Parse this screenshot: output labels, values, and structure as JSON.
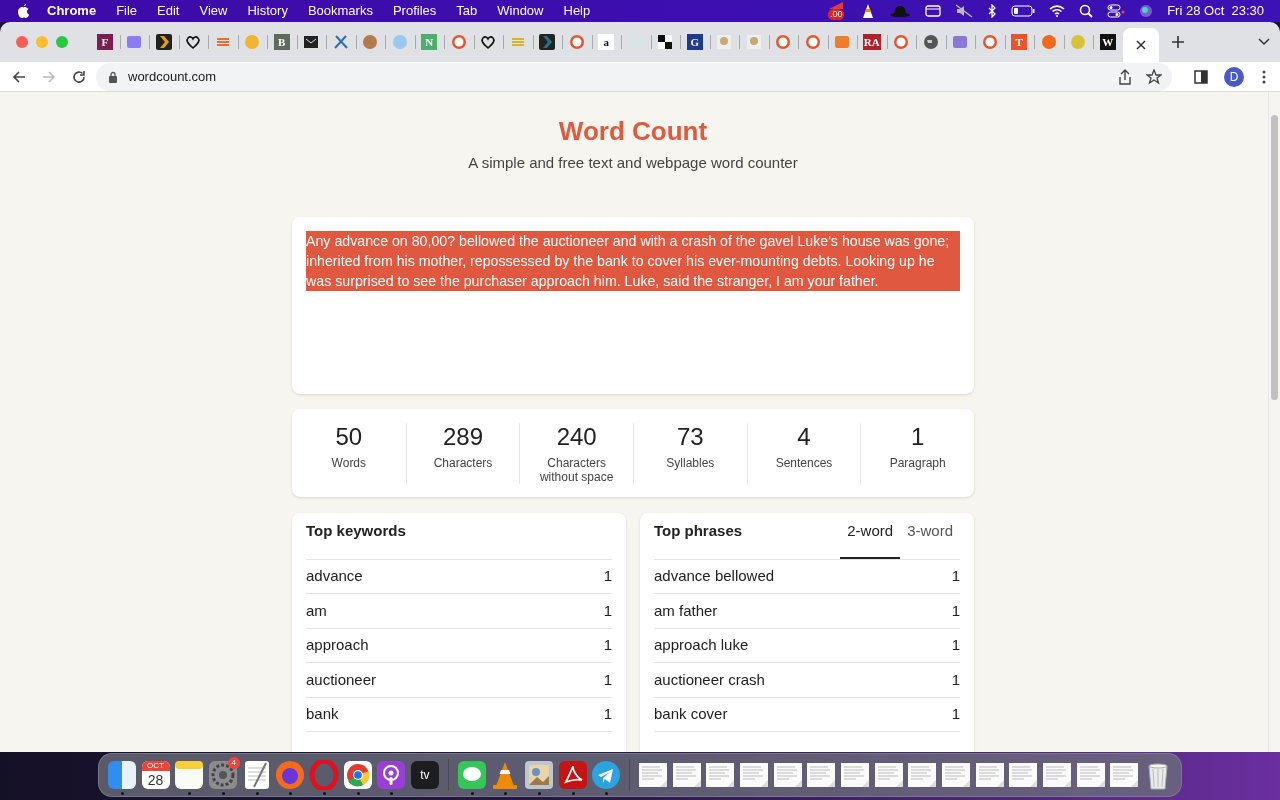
{
  "menu_bar": {
    "app": "Chrome",
    "items": [
      "File",
      "Edit",
      "View",
      "History",
      "Bookmarks",
      "Profiles",
      "Tab",
      "Window",
      "Help"
    ],
    "status_badge": ".00",
    "clock": "Fri 28 Oct  23:30"
  },
  "tabs": [
    {
      "kind": "letter",
      "letter": "F",
      "color": "#7a1f4f",
      "selected": false
    },
    {
      "kind": "square",
      "color": "#8b7cf6",
      "selected": false
    },
    {
      "kind": "chevron",
      "color": "#e5a00d",
      "selected": false
    },
    {
      "kind": "heart",
      "color": "#111111",
      "selected": false
    },
    {
      "kind": "stripes",
      "color": "#e0703a",
      "selected": false
    },
    {
      "kind": "circle",
      "color": "#f2b533",
      "selected": false
    },
    {
      "kind": "letter",
      "letter": "B",
      "color": "#5d6b5e",
      "selected": false
    },
    {
      "kind": "envelope",
      "color": "#222222",
      "selected": false
    },
    {
      "kind": "cross",
      "color": "#2f6fb0",
      "selected": false
    },
    {
      "kind": "circle",
      "color": "#b27b4e",
      "selected": false
    },
    {
      "kind": "circle",
      "color": "#9cc8ef",
      "selected": false
    },
    {
      "kind": "letter",
      "letter": "N",
      "color": "#4caf6e",
      "selected": false
    },
    {
      "kind": "ring",
      "color": "#de5833",
      "selected": false
    },
    {
      "kind": "heart",
      "color": "#111111",
      "selected": false
    },
    {
      "kind": "stripes",
      "color": "#d4b52b",
      "selected": false
    },
    {
      "kind": "chevron",
      "color": "#2a6f7d",
      "selected": false
    },
    {
      "kind": "ring",
      "color": "#de5833",
      "selected": false
    },
    {
      "kind": "letter",
      "letter": "a",
      "color": "#ffffff",
      "selected": false
    },
    {
      "kind": "square",
      "color": "#d6e6e6",
      "selected": false
    },
    {
      "kind": "grid",
      "color": "#111111",
      "selected": false
    },
    {
      "kind": "letter",
      "letter": "G",
      "color": "#1e3a8a",
      "selected": false
    },
    {
      "kind": "photo",
      "color": "#c9a77a",
      "selected": false
    },
    {
      "kind": "photo",
      "color": "#c9a77a",
      "selected": false
    },
    {
      "kind": "ring",
      "color": "#de5833",
      "selected": false
    },
    {
      "kind": "ring",
      "color": "#de5833",
      "selected": false
    },
    {
      "kind": "square",
      "color": "#ef7d2c",
      "selected": false
    },
    {
      "kind": "letter",
      "letter": "RA",
      "color": "#b0202a",
      "selected": false
    },
    {
      "kind": "ring",
      "color": "#de5833",
      "selected": false
    },
    {
      "kind": "globe",
      "color": "#555555",
      "selected": false
    },
    {
      "kind": "square",
      "color": "#8a78d8",
      "selected": false
    },
    {
      "kind": "ring",
      "color": "#de5833",
      "selected": false
    },
    {
      "kind": "letter",
      "letter": "T",
      "color": "#e8542d",
      "selected": false
    },
    {
      "kind": "circle",
      "color": "#f06a1a",
      "selected": false
    },
    {
      "kind": "circle",
      "color": "#d8c23a",
      "selected": false
    },
    {
      "kind": "letter",
      "letter": "W",
      "color": "#111111",
      "selected": false
    },
    {
      "kind": "close",
      "selected": true
    }
  ],
  "address_bar": {
    "url": "wordcount.com",
    "avatar": "D"
  },
  "page": {
    "title": "Word Count",
    "subtitle": "A simple and free text and webpage word counter",
    "text": "Any advance on 80,00? bellowed the auctioneer and with a crash of the gavel Luke's house was gone; inherited from his mother, repossessed by the bank to cover his ever-mounting debts. Looking up he was surprised to see the purchaser approach him. Luke, said the stranger, I am your father.",
    "text_selected": true,
    "stats": [
      {
        "value": "50",
        "label": "Words"
      },
      {
        "value": "289",
        "label": "Characters"
      },
      {
        "value": "240",
        "label": "Characters without space"
      },
      {
        "value": "73",
        "label": "Syllables"
      },
      {
        "value": "4",
        "label": "Sentences"
      },
      {
        "value": "1",
        "label": "Paragraph"
      }
    ],
    "keywords": {
      "title": "Top keywords",
      "rows": [
        {
          "term": "advance",
          "count": "1"
        },
        {
          "term": "am",
          "count": "1"
        },
        {
          "term": "approach",
          "count": "1"
        },
        {
          "term": "auctioneer",
          "count": "1"
        },
        {
          "term": "bank",
          "count": "1"
        }
      ]
    },
    "phrases": {
      "title": "Top phrases",
      "tabs": [
        {
          "label": "2-word",
          "selected": true
        },
        {
          "label": "3-word",
          "selected": false
        }
      ],
      "rows": [
        {
          "term": "advance bellowed",
          "count": "1"
        },
        {
          "term": "am father",
          "count": "1"
        },
        {
          "term": "approach luke",
          "count": "1"
        },
        {
          "term": "auctioneer crash",
          "count": "1"
        },
        {
          "term": "bank cover",
          "count": "1"
        }
      ]
    }
  },
  "dock": {
    "sections": [
      {
        "items": [
          {
            "kind": "finder",
            "running": true
          },
          {
            "kind": "calendar",
            "month": "OCT",
            "day": "28",
            "running": false
          },
          {
            "kind": "notes",
            "running": true
          },
          {
            "kind": "settings",
            "badge": "4",
            "running": true
          },
          {
            "kind": "textedit",
            "running": true
          },
          {
            "kind": "firefox",
            "running": true
          },
          {
            "kind": "opera",
            "running": true
          },
          {
            "kind": "chrome",
            "running": true
          },
          {
            "kind": "podcasts",
            "running": true
          },
          {
            "kind": "tv",
            "label": "tv",
            "running": false
          }
        ]
      },
      {
        "items": [
          {
            "kind": "messages",
            "running": true
          },
          {
            "kind": "vlc",
            "running": true
          },
          {
            "kind": "preview",
            "running": true
          },
          {
            "kind": "acrobat",
            "running": true
          },
          {
            "kind": "telegram",
            "running": true
          }
        ]
      },
      {
        "items": [
          {
            "kind": "document"
          },
          {
            "kind": "document"
          },
          {
            "kind": "document"
          },
          {
            "kind": "document"
          },
          {
            "kind": "document"
          },
          {
            "kind": "document"
          },
          {
            "kind": "document"
          },
          {
            "kind": "document"
          },
          {
            "kind": "document"
          },
          {
            "kind": "document"
          },
          {
            "kind": "document"
          },
          {
            "kind": "document"
          },
          {
            "kind": "document"
          },
          {
            "kind": "document"
          },
          {
            "kind": "document"
          },
          {
            "kind": "trash"
          }
        ]
      }
    ]
  }
}
